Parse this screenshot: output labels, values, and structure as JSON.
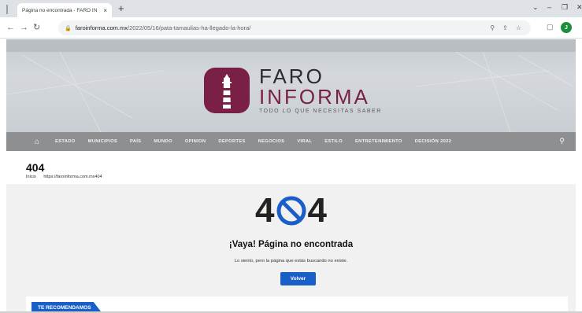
{
  "browser": {
    "tab_title": "Página no encontrada - FARO IN",
    "tab_close": "×",
    "new_tab": "+",
    "url_host": "faroinforma.com.mx",
    "url_path": "/2022/05/16/pata-tamaulias-ha-llegado-la-hora/",
    "profile_initial": "J",
    "controls": {
      "minimize": "–",
      "restore": "❐",
      "close": "✕"
    }
  },
  "site": {
    "logo_line1": "FARO",
    "logo_line2": "INFORMA",
    "tagline": "TODO LO QUE NECESITAS SABER",
    "brand_color": "#7a1f45",
    "nav": [
      "ESTADO",
      "MUNICIPIOS",
      "PAÍS",
      "MUNDO",
      "OPINION",
      "DEPORTES",
      "NEGOCIOS",
      "VIRAL",
      "ESTILO",
      "ENTRETENIMIENTO",
      "DECISIÓN 2022"
    ]
  },
  "page": {
    "title": "404",
    "breadcrumb_home": "Inicio",
    "breadcrumb_current": "https://faroinforma.com.mx404",
    "big_left": "4",
    "big_right": "4",
    "heading": "¡Vaya! Página no encontrada",
    "message": "Lo siento, pero la página que estás buscando no existe.",
    "button": "Volver",
    "recommend": "TE RECOMENDAMOS"
  },
  "colors": {
    "accent_blue": "#1a5fc8",
    "navbar": "#8e8f91"
  }
}
